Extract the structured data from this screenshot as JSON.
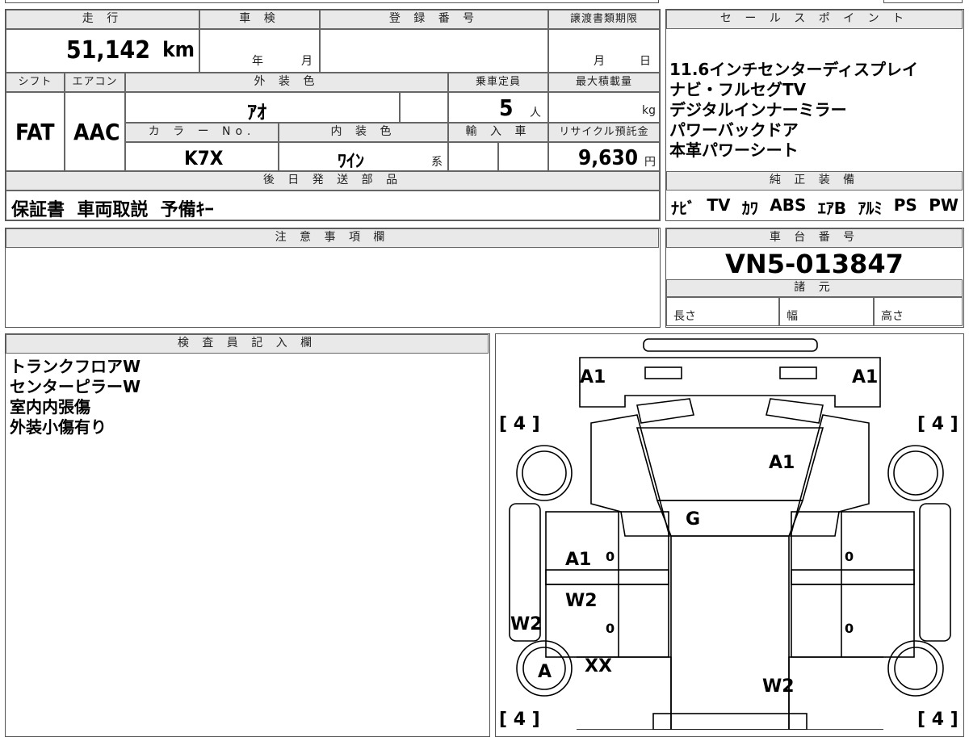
{
  "top_table": {
    "mileage_header": "走 行",
    "mileage_value": "51,142",
    "mileage_unit": "km",
    "shaken_header": "車 検",
    "shaken_year": "年",
    "shaken_month": "月",
    "registration_header": "登 録 番 号",
    "transfer_header": "譲渡書類期限",
    "transfer_month": "月",
    "transfer_day": "日",
    "shift_header": "シフト",
    "shift_value": "FAT",
    "aircon_header": "エアコン",
    "aircon_value": "AAC",
    "exterior_header": "外 装 色",
    "exterior_value": "ｱｵ",
    "capacity_header": "乗車定員",
    "capacity_value": "5",
    "capacity_unit": "人",
    "max_load_header": "最大積載量",
    "max_load_unit": "kg",
    "color_no_header": "カ ラ ー No.",
    "color_no_value": "K7X",
    "interior_header": "内 装 色",
    "interior_value": "ﾜｲﾝ",
    "interior_suffix": "系",
    "import_header": "輸 入 車",
    "recycle_header": "リサイクル預託金",
    "recycle_value": "9,630",
    "recycle_unit": "円",
    "shipping_header": "後 日 発 送 部 品",
    "shipping_items": "保証書  車両取説  予備ｷｰ"
  },
  "sales_points": {
    "header": "セ ー ル ス ポ イ ン ト",
    "items": [
      "11.6インチセンターディスプレイ",
      "ナビ・フルセグTV",
      "デジタルインナーミラー",
      "パワーバックドア",
      "本革パワーシート"
    ]
  },
  "equipment": {
    "header": "純 正 装 備",
    "items": [
      "ﾅﾋﾞ",
      "TV",
      "ｶﾜ",
      "ABS",
      "ｴｱB",
      "ｱﾙﾐ",
      "PS",
      "PW"
    ]
  },
  "notes": {
    "header": "注 意 事 項 欄"
  },
  "chassis": {
    "header": "車 台 番 号",
    "value": "VN5-013847",
    "spec_header": "諸 元",
    "length_label": "長さ",
    "width_label": "幅",
    "height_label": "高さ"
  },
  "inspector": {
    "header": "検 査 員 記 入 欄",
    "lines": [
      "トランクフロアW",
      "センターピラーW",
      "室内内張傷",
      "外装小傷有り"
    ]
  },
  "diagram": {
    "tire_brackets": [
      "[ 4 ]",
      "[ 4 ]",
      "[ 4 ]",
      "[ 4 ]"
    ],
    "marks": {
      "front_left": "A1",
      "front_right": "A1",
      "hood": "A1",
      "windshield": "G",
      "front_door_left": "A1",
      "rear_door_left": "W2",
      "pillar_left": "W2",
      "wheel_left": "A",
      "quarter_left": "XX",
      "rear_right": "W2",
      "zero": "0"
    }
  }
}
